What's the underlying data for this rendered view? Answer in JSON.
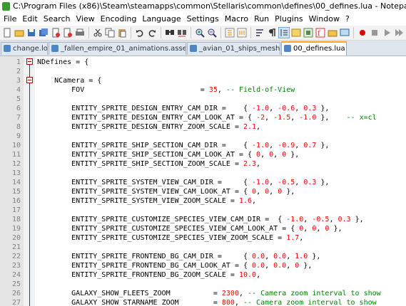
{
  "window": {
    "title": "C:\\Program Files (x86)\\Steam\\steamapps\\common\\Stellaris\\common\\defines\\00_defines.lua - Notepad++"
  },
  "menu": [
    "File",
    "Edit",
    "Search",
    "View",
    "Encoding",
    "Language",
    "Settings",
    "Macro",
    "Run",
    "Plugins",
    "Window",
    "?"
  ],
  "tabs": [
    {
      "label": "change.log",
      "active": false
    },
    {
      "label": "_fallen_empire_01_animations.asset",
      "active": false
    },
    {
      "label": "_avian_01_ships_meshes.gfx",
      "active": false
    },
    {
      "label": "00_defines.lua",
      "active": true
    }
  ],
  "colors": {
    "number": "#ff0000",
    "comment": "#008000",
    "fold": "#c00000",
    "active_tab_accent": "#f9a825"
  },
  "lines": [
    {
      "n": "1",
      "code": "NDefines = {"
    },
    {
      "n": "2",
      "code": ""
    },
    {
      "n": "3",
      "code": "    NCamera = {"
    },
    {
      "n": "4",
      "code": "        FOV                           = 35, -- Field-of-View"
    },
    {
      "n": "5",
      "code": ""
    },
    {
      "n": "6",
      "code": "        ENTITY_SPRITE_DESIGN_ENTRY_CAM_DIR =    { -1.0, -0.6, 0.3 },"
    },
    {
      "n": "7",
      "code": "        ENTITY_SPRITE_DESIGN_ENTRY_CAM_LOOK_AT = { -2, -1.5, -1.0 },    -- x=cl"
    },
    {
      "n": "8",
      "code": "        ENTITY_SPRITE_DESIGN_ENTRY_ZOOM_SCALE = 2.1,"
    },
    {
      "n": "9",
      "code": ""
    },
    {
      "n": "10",
      "code": "        ENTITY_SPRITE_SHIP_SECTION_CAM_DIR =    { -1.0, -0.9, 0.7 },"
    },
    {
      "n": "11",
      "code": "        ENTITY_SPRITE_SHIP_SECTION_CAM_LOOK_AT = { 0, 0, 0 },"
    },
    {
      "n": "12",
      "code": "        ENTITY_SPRITE_SHIP_SECTION_ZOOM_SCALE = 2.3,"
    },
    {
      "n": "13",
      "code": ""
    },
    {
      "n": "14",
      "code": "        ENTITY_SPRITE_SYSTEM_VIEW_CAM_DIR =     { -1.0, -0.5, 0.3 },"
    },
    {
      "n": "15",
      "code": "        ENTITY_SPRITE_SYSTEM_VIEW_CAM_LOOK_AT = { 0, 0, 0 },"
    },
    {
      "n": "16",
      "code": "        ENTITY_SPRITE_SYSTEM_VIEW_ZOOM_SCALE = 1.6,"
    },
    {
      "n": "17",
      "code": ""
    },
    {
      "n": "18",
      "code": "        ENTITY_SPRITE_CUSTOMIZE_SPECIES_VIEW_CAM_DIR =  { -1.0, -0.5, 0.3 },"
    },
    {
      "n": "19",
      "code": "        ENTITY_SPRITE_CUSTOMIZE_SPECIES_VIEW_CAM_LOOK_AT = { 0, 0, 0 },"
    },
    {
      "n": "20",
      "code": "        ENTITY_SPRITE_CUSTOMIZE_SPECIES_VIEW_ZOOM_SCALE = 1.7,"
    },
    {
      "n": "21",
      "code": ""
    },
    {
      "n": "22",
      "code": "        ENTITY_SPRITE_FRONTEND_BG_CAM_DIR =     { 0.0, 0.0, 1.0 },"
    },
    {
      "n": "23",
      "code": "        ENTITY_SPRITE_FRONTEND_BG_CAM_LOOK_AT = { 0.0, 0.0, 0 },"
    },
    {
      "n": "24",
      "code": "        ENTITY_SPRITE_FRONTEND_BG_ZOOM_SCALE = 10.0,"
    },
    {
      "n": "25",
      "code": ""
    },
    {
      "n": "26",
      "code": "        GALAXY_SHOW_FLEETS_ZOOM          = 2300, -- Camera zoom interval to show"
    },
    {
      "n": "27",
      "code": "        GALAXY_SHOW_STARNAME_ZOOM        = 800, -- Camera zoom interval to show"
    }
  ]
}
